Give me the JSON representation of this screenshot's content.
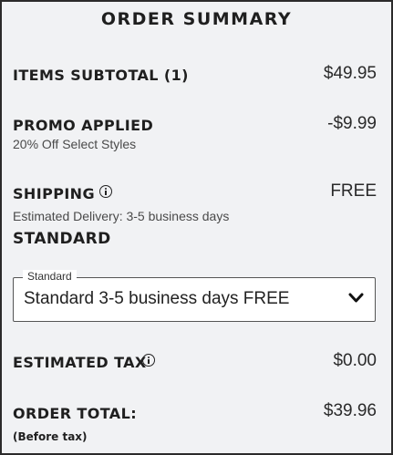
{
  "summary": {
    "title": "ORDER SUMMARY",
    "items_subtotal": {
      "label": "ITEMS SUBTOTAL (1)",
      "amount": "$49.95"
    },
    "promo": {
      "label": "PROMO APPLIED",
      "amount": "-$9.99",
      "detail": "20% Off Select Styles"
    },
    "shipping": {
      "label": "SHIPPING",
      "amount": "FREE",
      "estimate": "Estimated Delivery: 3-5 business days",
      "method_heading": "STANDARD",
      "select": {
        "legend": "Standard",
        "value": "Standard 3-5 business days FREE"
      }
    },
    "tax": {
      "label": "ESTIMATED TAX",
      "amount": "$0.00"
    },
    "total": {
      "label": "ORDER TOTAL:",
      "amount": "$39.96",
      "note": "(Before tax)"
    }
  },
  "icons": {
    "info": "info-circle-icon",
    "dropdown": "chevron-down-icon"
  }
}
